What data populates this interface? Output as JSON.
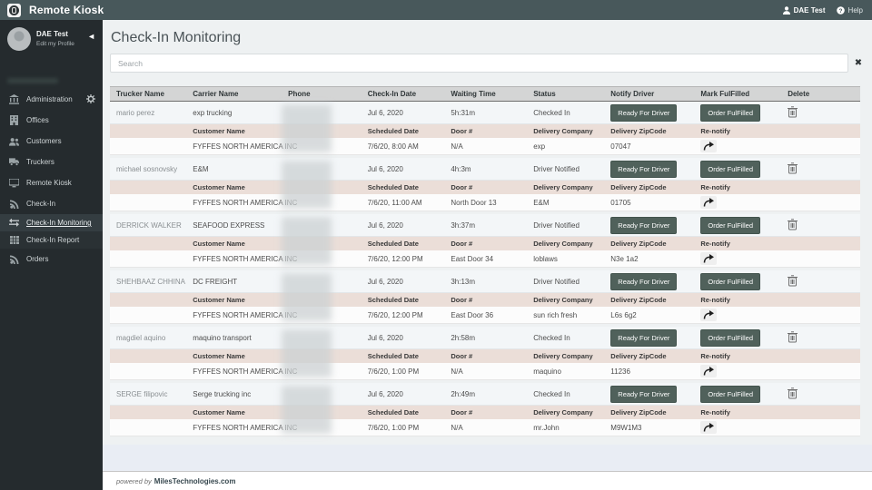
{
  "topbar": {
    "app_title": "Remote Kiosk",
    "user_label": "DAE Test",
    "help_label": "Help"
  },
  "sidebar": {
    "profile": {
      "name": "DAE Test",
      "edit_label": "Edit my Profile"
    },
    "items": {
      "administration": "Administration",
      "offices": "Offices",
      "customers": "Customers",
      "truckers": "Truckers",
      "remote_kiosk": "Remote Kiosk",
      "check_in": "Check-In",
      "check_in_monitoring": "Check-In Monitoring",
      "check_in_report": "Check-In Report",
      "orders": "Orders"
    }
  },
  "main": {
    "page_title": "Check-In Monitoring",
    "search_placeholder": "Search",
    "clear_icon": "✖",
    "table": {
      "columns": [
        "Trucker Name",
        "Carrier Name",
        "Phone",
        "Check-In Date",
        "Waiting Time",
        "Status",
        "Notify Driver",
        "Mark FulFilled",
        "Delete"
      ],
      "sub_columns": [
        "Customer Name",
        "Scheduled Date",
        "Door #",
        "Delivery Company",
        "Delivery ZipCode",
        "Re-notify"
      ],
      "notify_button_label": "Ready For Driver",
      "fulfill_button_label": "Order FulFilled",
      "rows": [
        {
          "trucker_name": "mario perez",
          "carrier_name": "exp trucking",
          "check_in_date": "Jul 6, 2020",
          "waiting_time": "5h:31m",
          "status": "Checked In",
          "customer_name": "FYFFES NORTH AMERICA INC",
          "scheduled_date": "7/6/20, 8:00 AM",
          "door": "N/A",
          "delivery_company": "exp",
          "delivery_zipcode": "07047"
        },
        {
          "trucker_name": "michael sosnovsky",
          "carrier_name": "E&M",
          "check_in_date": "Jul 6, 2020",
          "waiting_time": "4h:3m",
          "status": "Driver Notified",
          "customer_name": "FYFFES NORTH AMERICA INC",
          "scheduled_date": "7/6/20, 11:00 AM",
          "door": "North Door 13",
          "delivery_company": "E&M",
          "delivery_zipcode": "01705"
        },
        {
          "trucker_name": "DERRICK WALKER",
          "carrier_name": "SEAFOOD EXPRESS",
          "check_in_date": "Jul 6, 2020",
          "waiting_time": "3h:37m",
          "status": "Driver Notified",
          "customer_name": "FYFFES NORTH AMERICA INC",
          "scheduled_date": "7/6/20, 12:00 PM",
          "door": "East Door 34",
          "delivery_company": "loblaws",
          "delivery_zipcode": "N3e 1a2"
        },
        {
          "trucker_name": "SHEHBAAZ CHHINA",
          "carrier_name": "DC FREIGHT",
          "check_in_date": "Jul 6, 2020",
          "waiting_time": "3h:13m",
          "status": "Driver Notified",
          "customer_name": "FYFFES NORTH AMERICA INC",
          "scheduled_date": "7/6/20, 12:00 PM",
          "door": "East Door 36",
          "delivery_company": "sun rich fresh",
          "delivery_zipcode": "L6s 6g2"
        },
        {
          "trucker_name": "magdiel aquino",
          "carrier_name": "maquino transport",
          "check_in_date": "Jul 6, 2020",
          "waiting_time": "2h:58m",
          "status": "Checked In",
          "customer_name": "FYFFES NORTH AMERICA INC",
          "scheduled_date": "7/6/20, 1:00 PM",
          "door": "N/A",
          "delivery_company": "maquino",
          "delivery_zipcode": "11236"
        },
        {
          "trucker_name": "SERGE filipovic",
          "carrier_name": "Serge trucking inc",
          "check_in_date": "Jul 6, 2020",
          "waiting_time": "2h:49m",
          "status": "Checked In",
          "customer_name": "FYFFES NORTH AMERICA INC",
          "scheduled_date": "7/6/20, 1:00 PM",
          "door": "N/A",
          "delivery_company": "mr.John",
          "delivery_zipcode": "M9W1M3"
        }
      ]
    }
  },
  "footer": {
    "powered_by": "powered by",
    "link_label": "MilesTechnologies.com"
  },
  "colors": {
    "topbar": "#48585b",
    "sidebar": "#252b2e",
    "button": "#50615b",
    "subheader": "#ebded8",
    "accent_row": "#f3f6f8"
  }
}
